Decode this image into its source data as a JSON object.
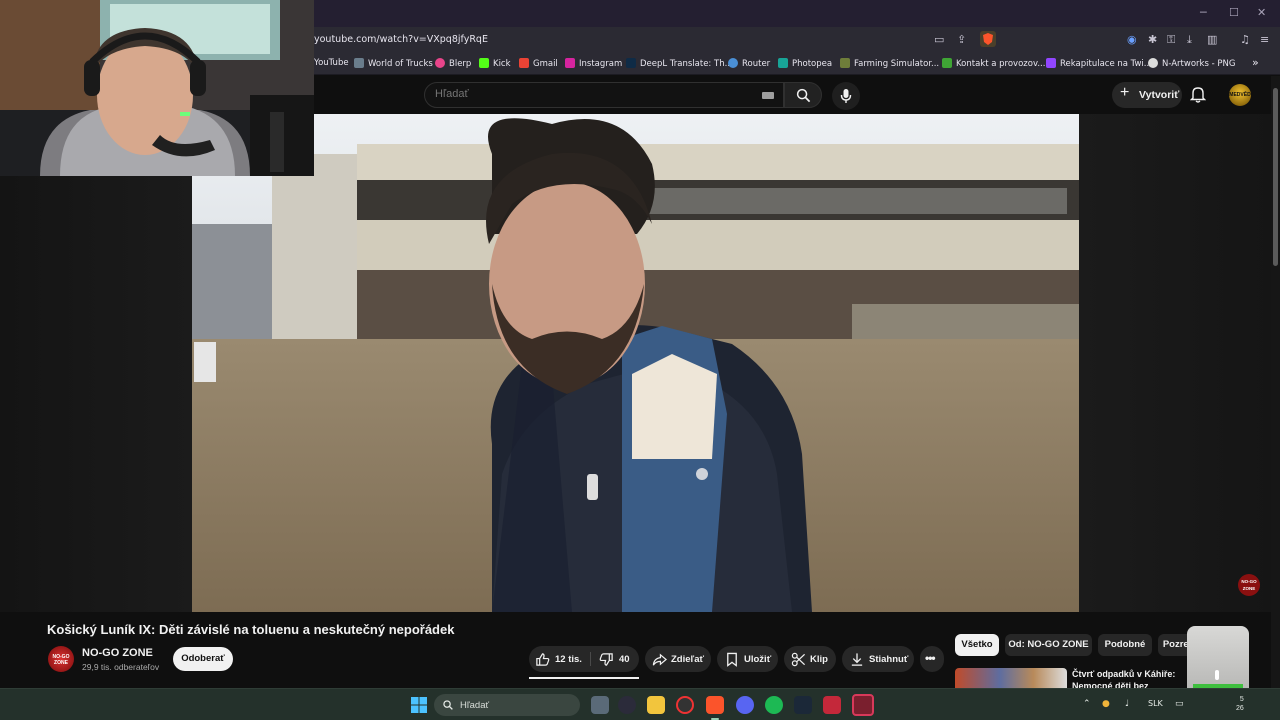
{
  "browser": {
    "url": "youtube.com/watch?v=VXpq8jfyRqE",
    "bookmarks": [
      {
        "label": "YouTube",
        "color": "#ff0000"
      },
      {
        "label": "World of Trucks",
        "color": "#6a7d8c"
      },
      {
        "label": "Blerp",
        "color": "#e8448a"
      },
      {
        "label": "Kick",
        "color": "#53fc18"
      },
      {
        "label": "Gmail",
        "color": "#ea4335"
      },
      {
        "label": "Instagram",
        "color": "#d6249f"
      },
      {
        "label": "DeepL Translate: Th...",
        "color": "#0f2b46"
      },
      {
        "label": "Router",
        "color": "#4a8fd6"
      },
      {
        "label": "Photopea",
        "color": "#18a497"
      },
      {
        "label": "Farming Simulator...",
        "color": "#6e7d3a"
      },
      {
        "label": "Kontakt a provozov...",
        "color": "#3fa535"
      },
      {
        "label": "Rekapitulace na Twi...",
        "color": "#9146ff"
      },
      {
        "label": "N-Artworks - PNG",
        "color": "#dddddd"
      }
    ],
    "overflow_icon": "chevrons-right-icon"
  },
  "youtube": {
    "search_placeholder": "Hľadať",
    "create_label": "Vytvoriť",
    "avatar_text": "MEDVĚD",
    "video": {
      "title": "Košický Luník IX: Děti závislé na toluenu a neskutečný nepořádek",
      "channel": "NO-GO ZONE",
      "channel_logo_text": "NO-GO ZONE",
      "subscribers": "29,9 tis. odberateľov",
      "subscribe_label": "Odoberať",
      "likes": "12 tis.",
      "dislikes": "40",
      "share_label": "Zdieľať",
      "save_label": "Uložiť",
      "clip_label": "Klip",
      "download_label": "Stiahnuť"
    },
    "chips": [
      "Všetko",
      "Od: NO-GO ZONE",
      "Podobné",
      "Pozreté"
    ],
    "recommendation": {
      "title": "Čtvrť odpadků v Káhiře: Nemocné děti bez pořádného"
    }
  },
  "taskbar": {
    "search_placeholder": "Hľadať",
    "language": "SLK",
    "clock_time": "5",
    "clock_date": "26"
  },
  "colors": {
    "yt_bg": "#0f0f0f",
    "pill_bg": "#272727",
    "taskbar_bg": "#24312b",
    "browser_bg": "#2b2a33"
  }
}
